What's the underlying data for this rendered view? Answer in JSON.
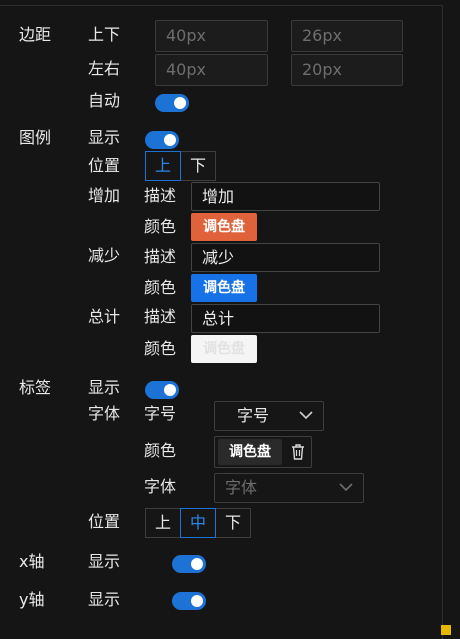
{
  "margin": {
    "label": "边距",
    "vertical_label": "上下",
    "horizontal_label": "左右",
    "top_placeholder": "40px",
    "bottom_placeholder": "26px",
    "left_placeholder": "40px",
    "right_placeholder": "20px",
    "auto_label": "自动",
    "auto_on": true
  },
  "legend": {
    "label": "图例",
    "show_label": "显示",
    "show_on": true,
    "position_label": "位置",
    "position_options": [
      "上",
      "下"
    ],
    "position_selected": "上",
    "increase": {
      "label": "增加",
      "desc_label": "描述",
      "desc_value": "增加",
      "color_label": "颜色",
      "swatch_text": "调色盘",
      "color": "#e0623a"
    },
    "decrease": {
      "label": "减少",
      "desc_label": "描述",
      "desc_value": "减少",
      "color_label": "颜色",
      "swatch_text": "调色盘",
      "color": "#1672e6"
    },
    "total": {
      "label": "总计",
      "desc_label": "描述",
      "desc_value": "总计",
      "color_label": "颜色",
      "swatch_text": "调色盘",
      "color": "#f5f5f5"
    }
  },
  "tags": {
    "label": "标签",
    "show_label": "显示",
    "show_on": true,
    "font_label": "字体",
    "size_label": "字号",
    "size_value": "字号",
    "color_label": "颜色",
    "color_swatch_text": "调色盘",
    "family_label": "字体",
    "family_placeholder": "字体",
    "position_label": "位置",
    "position_options": [
      "上",
      "中",
      "下"
    ],
    "position_selected": "中"
  },
  "x_axis": {
    "label": "x轴",
    "show_label": "显示",
    "show_on": true
  },
  "y_axis": {
    "label": "y轴",
    "show_label": "显示",
    "show_on": true
  },
  "colors": {
    "accent": "#1d72d6",
    "background": "#151515"
  }
}
